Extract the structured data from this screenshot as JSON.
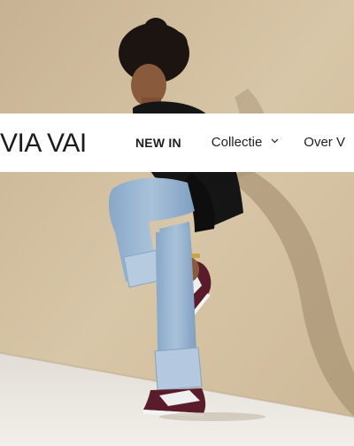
{
  "brand": {
    "logo_text": "VIA VAI"
  },
  "nav": {
    "items": [
      {
        "label": "NEW IN"
      },
      {
        "label": "Collectie",
        "icon": "chevron-down-icon"
      },
      {
        "label": "Over V"
      }
    ]
  },
  "colors": {
    "header_bg": "#ffffff",
    "wall": "#d8c9b1",
    "floor": "#ece8e2",
    "text": "#1f1f1f"
  }
}
